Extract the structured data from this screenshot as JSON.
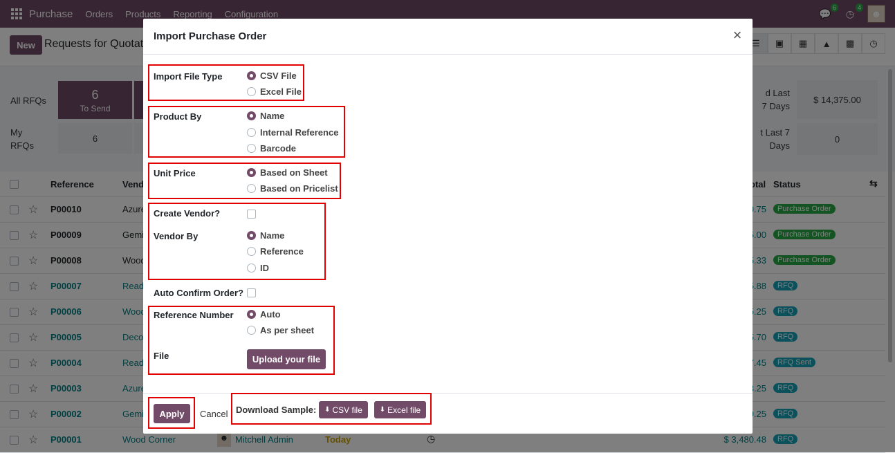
{
  "app": {
    "name": "Purchase",
    "menu": [
      "Orders",
      "Products",
      "Reporting",
      "Configuration"
    ],
    "notif_count_1": "6",
    "notif_count_2": "4"
  },
  "controlbar": {
    "new_label": "New",
    "breadcrumb": "Requests for Quotatio"
  },
  "dashboard": {
    "all_rfqs": "All RFQs",
    "my_rfqs": "My RFQs",
    "to_send_num": "6",
    "to_send_label": "To Send",
    "my_to_send": "6",
    "last7_1": "d Last 7 Days",
    "last7_2": "t Last 7 Days",
    "amount": "$ 14,375.00",
    "zero": "0"
  },
  "list": {
    "headers": {
      "reference": "Reference",
      "vendor": "Vend",
      "total": "otal",
      "status": "Status"
    },
    "rows": [
      {
        "ref": "P00010",
        "vendor": "Azure",
        "total": "0.75",
        "status": "Purchase Order",
        "kind": "po"
      },
      {
        "ref": "P00009",
        "vendor": "Gemi",
        "total": "5.00",
        "status": "Purchase Order",
        "kind": "po"
      },
      {
        "ref": "P00008",
        "vendor": "Wood",
        "total": "5.33",
        "status": "Purchase Order",
        "kind": "po"
      },
      {
        "ref": "P00007",
        "vendor": "Read",
        "total": "5.88",
        "status": "RFQ",
        "kind": "rfq"
      },
      {
        "ref": "P00006",
        "vendor": "Wood",
        "total": "5.25",
        "status": "RFQ",
        "kind": "rfq"
      },
      {
        "ref": "P00005",
        "vendor": "Deco",
        "total": "5.70",
        "status": "RFQ",
        "kind": "rfq"
      },
      {
        "ref": "P00004",
        "vendor": "Read",
        "total": "7.45",
        "status": "RFQ Sent",
        "kind": "rfq"
      },
      {
        "ref": "P00003",
        "vendor": "Azure",
        "total": "3.25",
        "status": "RFQ",
        "kind": "rfq"
      },
      {
        "ref": "P00002",
        "vendor": "Gemi",
        "total": "9.25",
        "status": "RFQ",
        "kind": "rfq"
      },
      {
        "ref": "P00001",
        "vendor": "Wood Corner",
        "buyer": "Mitchell Admin",
        "deadline": "Today",
        "total": "$ 3,480.48",
        "status": "RFQ",
        "kind": "rfq"
      }
    ]
  },
  "modal": {
    "title": "Import Purchase Order",
    "import_type": {
      "label": "Import File Type",
      "options": [
        "CSV File",
        "Excel File"
      ],
      "selected": 0
    },
    "product_by": {
      "label": "Product By",
      "options": [
        "Name",
        "Internal Reference",
        "Barcode"
      ],
      "selected": 0
    },
    "unit_price": {
      "label": "Unit Price",
      "options": [
        "Based on Sheet",
        "Based on Pricelist"
      ],
      "selected": 0
    },
    "create_vendor": {
      "label": "Create Vendor?"
    },
    "vendor_by": {
      "label": "Vendor By",
      "options": [
        "Name",
        "Reference",
        "ID"
      ],
      "selected": 0
    },
    "auto_confirm": {
      "label": "Auto Confirm Order?"
    },
    "reference_number": {
      "label": "Reference Number",
      "options": [
        "Auto",
        "As per sheet"
      ],
      "selected": 0
    },
    "file": {
      "label": "File",
      "upload_label": "Upload your file"
    },
    "footer": {
      "apply": "Apply",
      "cancel": "Cancel",
      "download_sample": "Download Sample:",
      "csv_file": "CSV file",
      "excel_file": "Excel file"
    }
  },
  "colors": {
    "primary": "#714B67",
    "highlight": "#e00000",
    "success": "#28a745",
    "info": "#17a2b8"
  }
}
